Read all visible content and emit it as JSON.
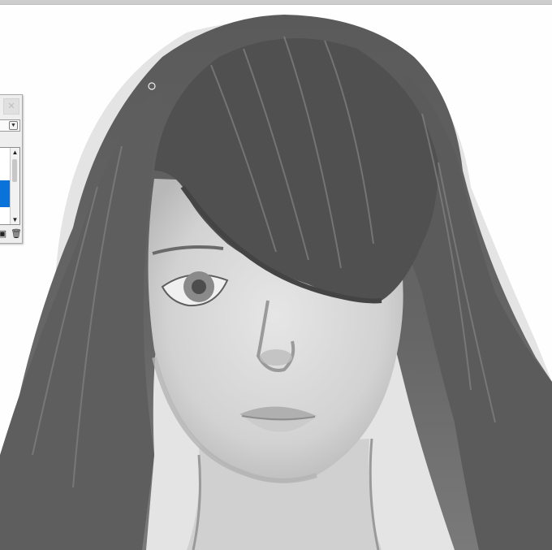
{
  "app": {
    "accent_color": "#0a73d9",
    "canvas_background": "#ffffff"
  },
  "layer_panel": {
    "close_icon": "close-icon",
    "dropdown_icon": "chevron-down-icon",
    "scroll_up_icon": "scroll-up-icon",
    "scroll_down_icon": "scroll-down-icon",
    "toolbar_icons": [
      "layer-stack-icon",
      "trash-icon"
    ]
  },
  "canvas": {
    "artwork": "grayscale-portrait",
    "brush_cursor_icon": "brush-cursor-icon"
  }
}
